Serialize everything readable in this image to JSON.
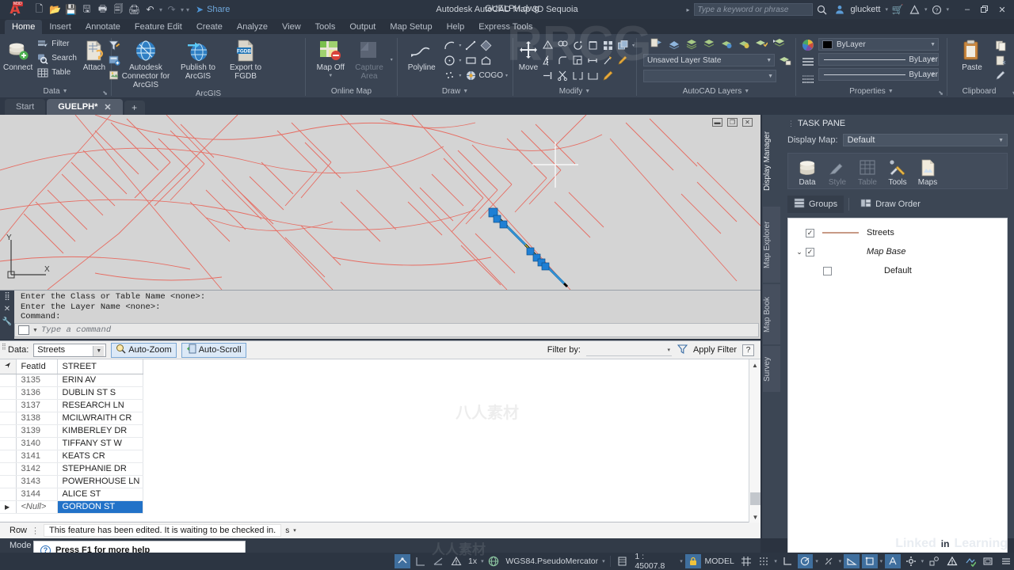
{
  "titlebar": {
    "app_title": "Autodesk AutoCAD Map 3D Sequoia",
    "document": "GUELPH.dwg",
    "share_label": "Share",
    "search_placeholder": "Type a keyword or phrase",
    "user": "gluckett",
    "quick_access": [
      {
        "name": "new-icon",
        "glyph": "🗋"
      },
      {
        "name": "open-icon",
        "glyph": "📂"
      },
      {
        "name": "save-icon",
        "glyph": "💾"
      },
      {
        "name": "saveas-icon",
        "glyph": "💾"
      },
      {
        "name": "plot-preview-icon",
        "glyph": "🖨"
      },
      {
        "name": "publish-icon",
        "glyph": "📑"
      },
      {
        "name": "print-icon",
        "glyph": "🖨"
      },
      {
        "name": "undo-icon",
        "glyph": "↶"
      },
      {
        "name": "redo-icon",
        "glyph": "↷"
      }
    ],
    "win_min": "–",
    "win_max": "❐",
    "win_close": "✕"
  },
  "ribbon_tabs": [
    {
      "label": "Home",
      "active": true
    },
    {
      "label": "Insert",
      "active": false
    },
    {
      "label": "Annotate",
      "active": false
    },
    {
      "label": "Feature Edit",
      "active": false
    },
    {
      "label": "Create",
      "active": false
    },
    {
      "label": "Analyze",
      "active": false
    },
    {
      "label": "View",
      "active": false
    },
    {
      "label": "Tools",
      "active": false
    },
    {
      "label": "Output",
      "active": false
    },
    {
      "label": "Map Setup",
      "active": false
    },
    {
      "label": "Help",
      "active": false
    },
    {
      "label": "Express Tools",
      "active": false
    }
  ],
  "ribbon": {
    "data_panel": {
      "title": "Data",
      "connect": "Connect",
      "filter": "Filter",
      "search": "Search",
      "table": "Table",
      "attach": "Attach"
    },
    "arcgis_panel": {
      "title": "ArcGIS",
      "connector": "Autodesk Connector for ArcGIS",
      "publish": "Publish to ArcGIS",
      "export": "Export to FGDB",
      "fgdb_badge": "FGDB"
    },
    "online_map_panel": {
      "title": "Online Map",
      "map_off": "Map Off",
      "capture_area": "Capture Area"
    },
    "draw_panel": {
      "title": "Draw",
      "polyline": "Polyline",
      "cogo": "COGO"
    },
    "modify_panel": {
      "title": "Modify",
      "move": "Move"
    },
    "layers_panel": {
      "title": "AutoCAD Layers",
      "layer_state": "Unsaved Layer State",
      "layer_current": ""
    },
    "properties_panel": {
      "title": "Properties",
      "color": "ByLayer",
      "linetype": "ByLayer",
      "lineweight": "ByLayer"
    },
    "clipboard_panel": {
      "title": "Clipboard",
      "paste": "Paste"
    }
  },
  "drawing_tabs": [
    {
      "label": "Start",
      "active": false,
      "closable": false
    },
    {
      "label": "GUELPH*",
      "active": true,
      "closable": true
    }
  ],
  "drawing_tab_add": "+",
  "canvas": {
    "win_minimize": "–",
    "win_restore": "❐",
    "win_close": "✕",
    "ucs_x": "X",
    "ucs_y": "Y",
    "street_color": "#e8675c",
    "selected_color": "#1f7fd4",
    "background": "#d4d4d4"
  },
  "command_line": {
    "history": [
      "Enter the Class or Table Name <none>:",
      "Enter the Layer Name <none>:",
      "Command:"
    ],
    "placeholder": "Type a command"
  },
  "data_table_toolbar": {
    "data_label": "Data:",
    "data_value": "Streets",
    "auto_zoom": "Auto-Zoom",
    "auto_scroll": "Auto-Scroll",
    "filter_by_label": "Filter by:",
    "filter_value": "",
    "apply_filter": "Apply Filter",
    "help": "?"
  },
  "data_table": {
    "columns": [
      "FeatId",
      "STREET"
    ],
    "rows": [
      {
        "featid": "3135",
        "street": "ERIN AV",
        "selected": false,
        "marker": ""
      },
      {
        "featid": "3136",
        "street": "DUBLIN ST S",
        "selected": false,
        "marker": ""
      },
      {
        "featid": "3137",
        "street": "RESEARCH LN",
        "selected": false,
        "marker": ""
      },
      {
        "featid": "3138",
        "street": "MCILWRAITH CR",
        "selected": false,
        "marker": ""
      },
      {
        "featid": "3139",
        "street": "KIMBERLEY DR",
        "selected": false,
        "marker": ""
      },
      {
        "featid": "3140",
        "street": "TIFFANY ST W",
        "selected": false,
        "marker": ""
      },
      {
        "featid": "3141",
        "street": "KEATS CR",
        "selected": false,
        "marker": ""
      },
      {
        "featid": "3142",
        "street": "STEPHANIE DR",
        "selected": false,
        "marker": ""
      },
      {
        "featid": "3143",
        "street": "POWERHOUSE LN",
        "selected": false,
        "marker": ""
      },
      {
        "featid": "3144",
        "street": "ALICE ST",
        "selected": false,
        "marker": ""
      },
      {
        "featid": "<Null>",
        "street": "GORDON ST",
        "selected": true,
        "marker": "▶"
      }
    ]
  },
  "row_status": {
    "label": "Row",
    "message": "This feature has been edited. It is waiting to be checked in.",
    "suffix": "s"
  },
  "mode_bar": {
    "label": "Mode"
  },
  "tooltip": {
    "text": "Press F1 for more help",
    "icon": "?"
  },
  "vertical_tabs": [
    {
      "label": "Display Manager",
      "active": true
    },
    {
      "label": "Map Explorer",
      "active": false
    },
    {
      "label": "Map Book",
      "active": false
    },
    {
      "label": "Survey",
      "active": false
    }
  ],
  "task_pane": {
    "title": "TASK PANE",
    "display_map_label": "Display Map:",
    "display_map_value": "Default",
    "tools": [
      {
        "label": "Data",
        "name": "data-tool",
        "enabled": true
      },
      {
        "label": "Style",
        "name": "style-tool",
        "enabled": false
      },
      {
        "label": "Table",
        "name": "table-tool",
        "enabled": false
      },
      {
        "label": "Tools",
        "name": "tools-tool",
        "enabled": true
      },
      {
        "label": "Maps",
        "name": "maps-tool",
        "enabled": true
      }
    ],
    "tabs": [
      {
        "label": "Groups",
        "active": true
      },
      {
        "label": "Draw Order",
        "active": false
      }
    ],
    "tree": [
      {
        "label": "Streets",
        "checked": true,
        "has_legend": true,
        "expander": "",
        "italic": false,
        "indent": 1
      },
      {
        "label": "Map Base",
        "checked": true,
        "has_legend": false,
        "expander": "⌄",
        "italic": true,
        "indent": 0
      },
      {
        "label": "Default",
        "checked": false,
        "has_legend": false,
        "expander": "",
        "italic": false,
        "indent": 2
      }
    ]
  },
  "status_bar": {
    "annotation_scale": "1x",
    "coordinate_system": "WGS84.PseudoMercator",
    "scale": "1 : 45007.8",
    "space": "MODEL",
    "brand": "Linked",
    "brand_in": "in",
    "brand2": "Learning"
  }
}
